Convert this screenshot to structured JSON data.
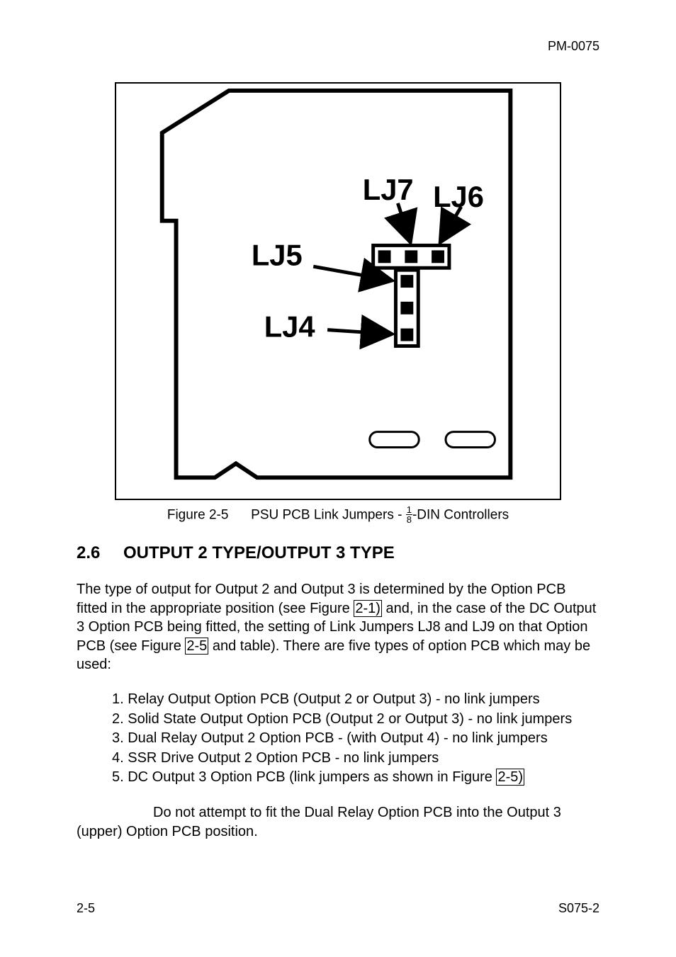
{
  "header": {
    "doc_id": "PM-0075"
  },
  "figure": {
    "labels": {
      "lj7": "LJ7",
      "lj6": "LJ6",
      "lj5": "LJ5",
      "lj4": "LJ4"
    },
    "caption_prefix": "Figure 2-5",
    "caption_text_a": "PSU PCB Link Jumpers - ",
    "caption_text_b": "-DIN Controllers",
    "fraction_num": "1",
    "fraction_den": "8"
  },
  "section": {
    "number": "2.6",
    "title": "OUTPUT 2 TYPE/OUTPUT 3 TYPE"
  },
  "paragraph": {
    "p1a": "The type of output for Output 2 and Output 3 is determined by the Option PCB fitted in the appropriate position (see Figure ",
    "ref21": "2-1)",
    "p1b": " and, in the case of the DC Output 3 Option PCB being fitted, the setting of Link Jumpers LJ8 and LJ9 on that Option PCB (see Figure ",
    "ref25a": "2-5",
    "p1c": " and table). There are five types of option PCB which may be used:"
  },
  "list": {
    "i1": "1. Relay Output Option PCB (Output 2 or Output 3) - no link jumpers",
    "i2": "2. Solid State Output Option PCB (Output 2 or Output 3) - no link jumpers",
    "i3": "3. Dual Relay Output 2 Option PCB - (with Output 4) - no link jumpers",
    "i4": "4. SSR Drive Output 2 Option PCB - no link jumpers",
    "i5a": "5. DC Output 3 Option PCB (link jumpers as shown in Figure ",
    "ref25b": "2-5)"
  },
  "note": "Do not attempt to fit the Dual Relay Option PCB into the Output 3 (upper) Option PCB position.",
  "footer": {
    "left": "2-5",
    "right": "S075-2"
  }
}
